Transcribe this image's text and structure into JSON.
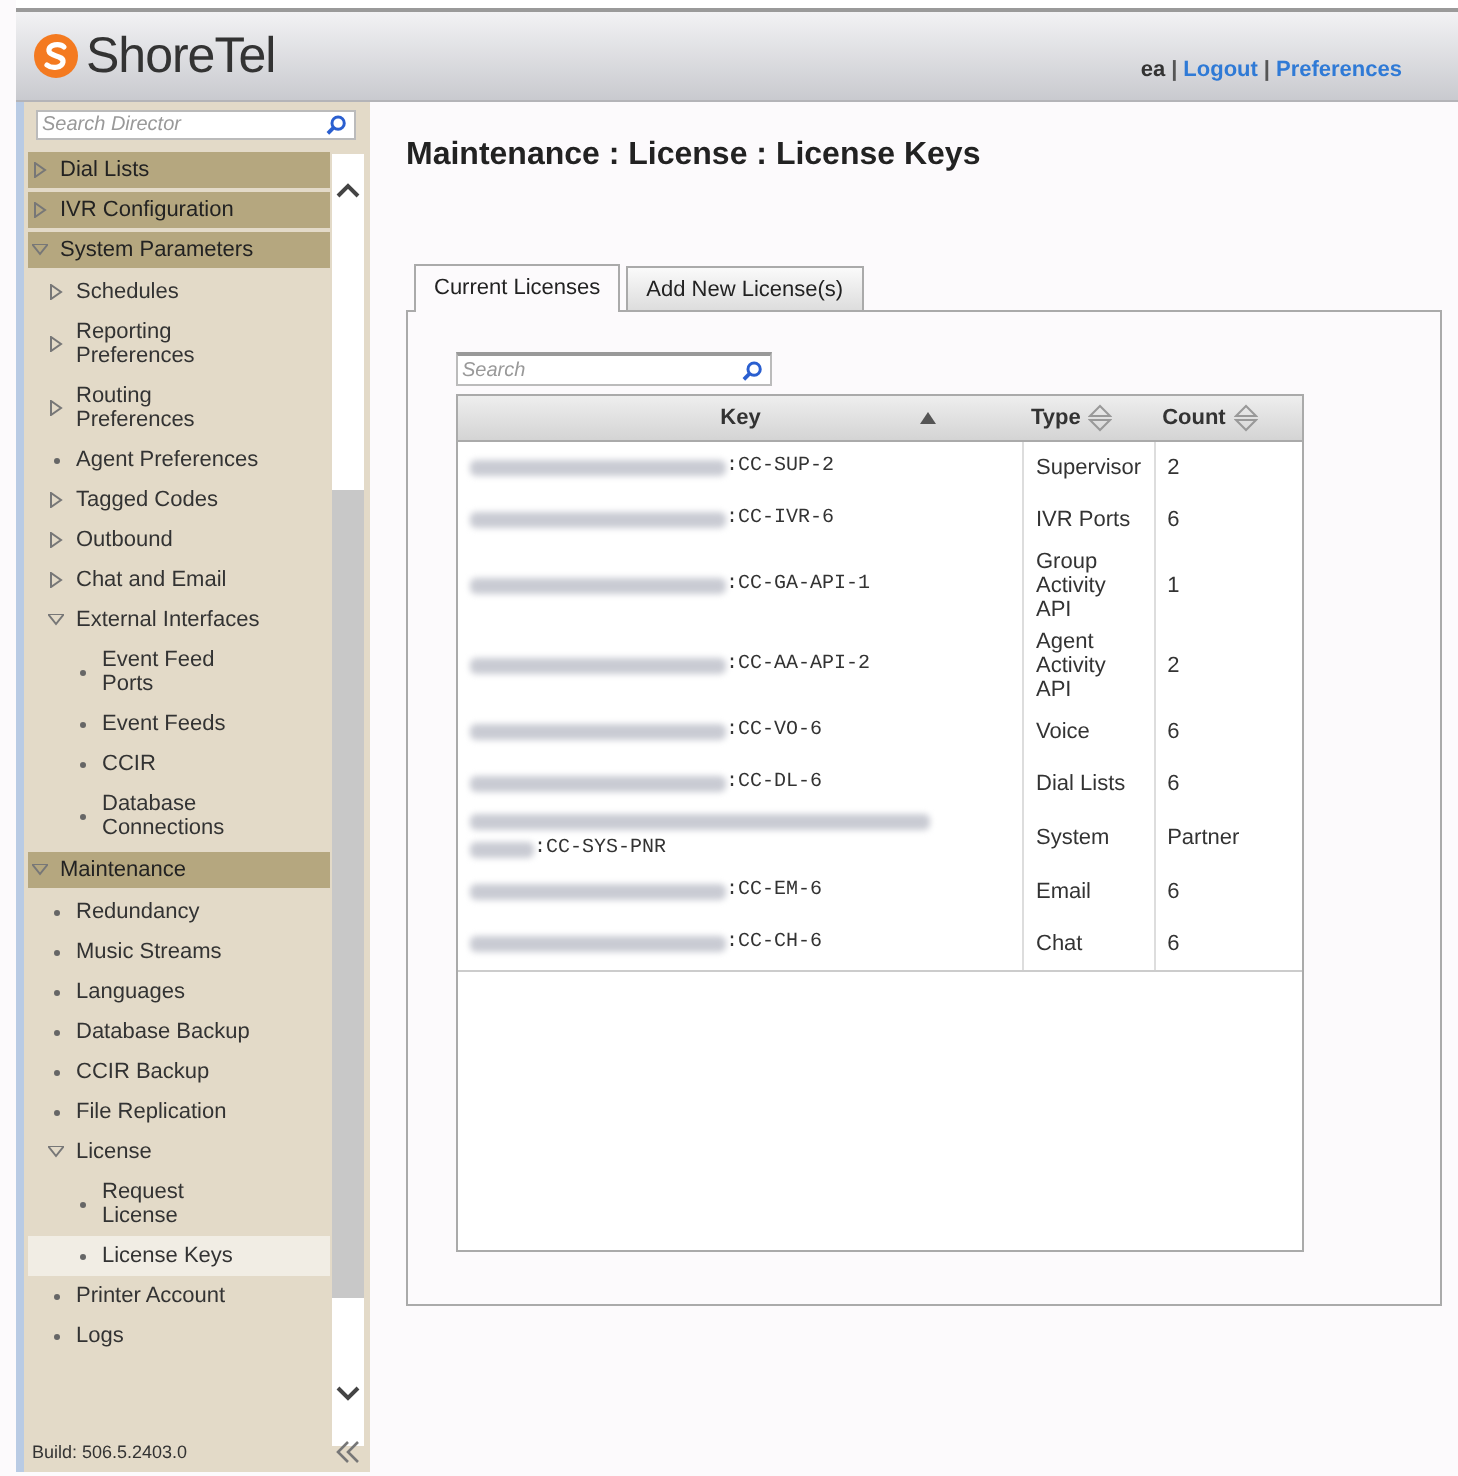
{
  "header": {
    "logo": "ShoreTel",
    "nav": [
      {
        "kind": "user",
        "label": "ea"
      },
      {
        "kind": "separator",
        "label": "|"
      },
      {
        "kind": "link",
        "label": "Logout"
      },
      {
        "kind": "separator",
        "label": "|"
      },
      {
        "kind": "link",
        "label": "Preferences"
      }
    ]
  },
  "sidebar": {
    "search": {
      "placeholder": "Search Director"
    },
    "items": [
      {
        "label": "Dial Lists",
        "kind": "folder",
        "expanded": false,
        "selected": false
      },
      {
        "label": "IVR Configuration",
        "kind": "folder",
        "expanded": false,
        "selected": false
      },
      {
        "label": "System Parameters",
        "kind": "folder",
        "expanded": true,
        "selected": false,
        "children": [
          {
            "label": "Schedules",
            "kind": "folder",
            "expanded": false,
            "selected": false
          },
          {
            "label": "Reporting Preferences",
            "kind": "folder",
            "expanded": false,
            "selected": false
          },
          {
            "label": "Routing Preferences",
            "kind": "folder",
            "expanded": false,
            "selected": false
          },
          {
            "label": "Agent Preferences",
            "kind": "leaf",
            "selected": false
          },
          {
            "label": "Tagged Codes",
            "kind": "folder",
            "expanded": false,
            "selected": false
          },
          {
            "label": "Outbound",
            "kind": "folder",
            "expanded": false,
            "selected": false
          },
          {
            "label": "Chat and Email",
            "kind": "folder",
            "expanded": false,
            "selected": false
          },
          {
            "label": "External Interfaces",
            "kind": "folder",
            "expanded": true,
            "selected": false,
            "children": [
              {
                "label": "Event Feed Ports",
                "kind": "leaf",
                "selected": false
              },
              {
                "label": "Event Feeds",
                "kind": "leaf",
                "selected": false
              },
              {
                "label": "CCIR",
                "kind": "leaf",
                "selected": false
              },
              {
                "label": "Database Connections",
                "kind": "leaf",
                "selected": false
              }
            ]
          }
        ]
      },
      {
        "label": "Maintenance",
        "kind": "folder",
        "expanded": true,
        "selected": false,
        "children": [
          {
            "label": "Redundancy",
            "kind": "leaf",
            "selected": false
          },
          {
            "label": "Music Streams",
            "kind": "leaf",
            "selected": false
          },
          {
            "label": "Languages",
            "kind": "leaf",
            "selected": false
          },
          {
            "label": "Database Backup",
            "kind": "leaf",
            "selected": false
          },
          {
            "label": "CCIR Backup",
            "kind": "leaf",
            "selected": false
          },
          {
            "label": "File Replication",
            "kind": "leaf",
            "selected": false
          },
          {
            "label": "License",
            "kind": "folder",
            "expanded": true,
            "selected": false,
            "children": [
              {
                "label": "Request License",
                "kind": "leaf",
                "selected": false
              },
              {
                "label": "License Keys",
                "kind": "leaf",
                "selected": true
              }
            ]
          },
          {
            "label": "Printer Account",
            "kind": "leaf",
            "selected": false
          },
          {
            "label": "Logs",
            "kind": "leaf",
            "selected": false
          }
        ]
      }
    ],
    "build": "Build: 506.5.2403.0"
  },
  "page_title": "Maintenance : License : License Keys",
  "tabs": [
    {
      "label": "Current Licenses",
      "selected": true
    },
    {
      "label": "Add New License(s)",
      "selected": false
    }
  ],
  "table": {
    "search": {
      "placeholder": "Search"
    },
    "columns": [
      {
        "label": "Key",
        "sorted": true
      },
      {
        "label": "Type",
        "sorted": false
      },
      {
        "label": "Count",
        "sorted": false
      }
    ],
    "rows": [
      {
        "key": ":CC-SUP-2",
        "kind": "single",
        "type": "Supervisor",
        "count": "2"
      },
      {
        "key": ":CC-IVR-6",
        "kind": "single",
        "type": "IVR Ports",
        "count": "6"
      },
      {
        "key": ":CC-GA-API-1",
        "kind": "single",
        "type": "Group Activity API",
        "count": "1"
      },
      {
        "key": ":CC-AA-API-2",
        "kind": "single",
        "type": "Agent Activity API",
        "count": "2"
      },
      {
        "key": ":CC-VO-6",
        "kind": "single",
        "type": "Voice",
        "count": "6"
      },
      {
        "key": ":CC-DL-6",
        "kind": "single",
        "type": "Dial Lists",
        "count": "6"
      },
      {
        "key": ":CC-SYS-PNR",
        "kind": "wrapped",
        "type": "System",
        "count": "Partner"
      },
      {
        "key": ":CC-EM-6",
        "kind": "single",
        "type": "Email",
        "count": "6"
      },
      {
        "key": ":CC-CH-6",
        "kind": "single",
        "type": "Chat",
        "count": "6"
      }
    ]
  }
}
